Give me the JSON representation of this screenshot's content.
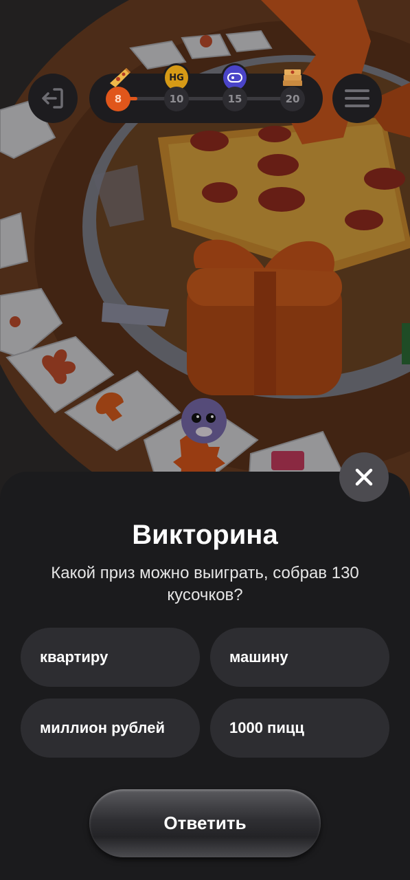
{
  "hud": {
    "progress_steps": [
      "8",
      "10",
      "15",
      "20"
    ],
    "active_step": "8",
    "rewards": [
      {
        "icon": "pizza-slice-icon",
        "label": ""
      },
      {
        "icon": "hg-badge-icon",
        "label": "HG"
      },
      {
        "icon": "ticket-badge-icon",
        "label": ""
      },
      {
        "icon": "pizza-box-stack-icon",
        "label": ""
      }
    ],
    "accent_color": "#e0561b"
  },
  "quiz": {
    "title": "Викторина",
    "question": "Какой приз можно выиграть, собрав 130 кусочков?",
    "options": [
      "квартиру",
      "машину",
      "миллион рублей",
      "1000 пицц"
    ],
    "answer_label": "Ответить"
  }
}
